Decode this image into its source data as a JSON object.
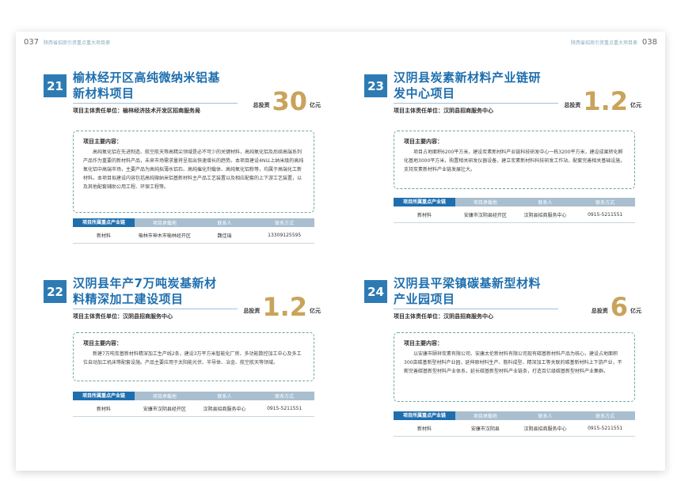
{
  "header": {
    "left_num": "037",
    "left_sub": "陕西省招商引资重点重大项目册",
    "right_num": "038",
    "right_sub": "陕西省招商引资重点重大项目册"
  },
  "labels": {
    "invest": "总投资",
    "unit": "亿元",
    "content_title": "项目主要内容：",
    "col_chain": "项目所属重点产业链",
    "col_site": "项目承载地",
    "col_contact": "联系人",
    "col_phone": "联系方式"
  },
  "projects": [
    {
      "num": "21",
      "title": "榆林经开区高纯微纳米铝基新材料项目",
      "resp": "项目主体责任单位：榆林经济技术开发区招商服务局",
      "amount": "30",
      "content": "高纯氧化铝在先进制造、航空航天等高精尖领域是必不可少的关键材料，高纯氧化铝及后续高端系列产品作为重要的新材料产品，未来市场需求量将呈现出快速增长的趋势。本项目建设4N以上纳米级的高纯氧化铝中高端市场，主要产品为高纯拟薄水铝石、高纯催化剂载体、高纯氧化铝粉等，均属于高端化工新材料。本项目拟建设内容包括高纯微纳米铝基新材料主产品工艺装置以及相应配套的上下游工艺装置，以及其他配套辅助公用工程、环保工程等。",
      "chain": "新材料",
      "site": "榆林市神木市榆林经开区",
      "contact": "魏佳瑞",
      "phone": "13309125595"
    },
    {
      "num": "23",
      "title": "汉阴县炭素新材料产业链研发中心项目",
      "resp": "项目主体责任单位：汉阴县招商服务中心",
      "amount": "1.2",
      "content": "项目占地面积6200平方米，建设炭素新材料产业链科技研发中心一栋3200平方米，建设成果转化孵化基地3000平方米，购置相关研发仪器设备，建立炭素新材料科技研发工作站，配套完善相关基础设施，支持炭素新材料产业链发展壮大。",
      "chain": "新材料",
      "site": "安康市汉阴县经开区",
      "contact": "汉阴县招商服务中心",
      "phone": "0915-5211551"
    },
    {
      "num": "22",
      "title": "汉阴县年产7万吨炭基新材料精深加工建设项目",
      "resp": "项目主体责任单位：汉阴县招商服务中心",
      "amount": "1.2",
      "content": "新建7万吨炭基新材料精深加工生产线2条，建设3万平方米智能化厂房、多功能数控加工中心及多工位自动加工机床等配套设施。产品主要应用于太阳能光伏、半导体、冶金、航空航天等领域。",
      "chain": "新材料",
      "site": "安康市汉阴县经开区",
      "contact": "汉阴县招商服务中心",
      "phone": "0915-5211551"
    },
    {
      "num": "24",
      "title": "汉阴县平梁镇碳基新型材料产业园项目",
      "resp": "项目主体责任单位：汉阴县招商服务中心",
      "amount": "6",
      "content": "以安康市颐祥炭素有限公司、安康太伦新材料有限公司现有碳基新材料产品为核心，建设占地面积300亩碳基新型材料产业园，延伸原材料生产、筋料成型、精深加工等关联的碳基新材料上下游产业，不断完善碳基新型材料产业体系，延长碳基新型材料产业链条，打造百亿级碳基新型材料产业集群。",
      "chain": "新材料",
      "site": "安康市汉阴县",
      "contact": "汉阴县招商服务中心",
      "phone": "0915-5211551"
    }
  ]
}
